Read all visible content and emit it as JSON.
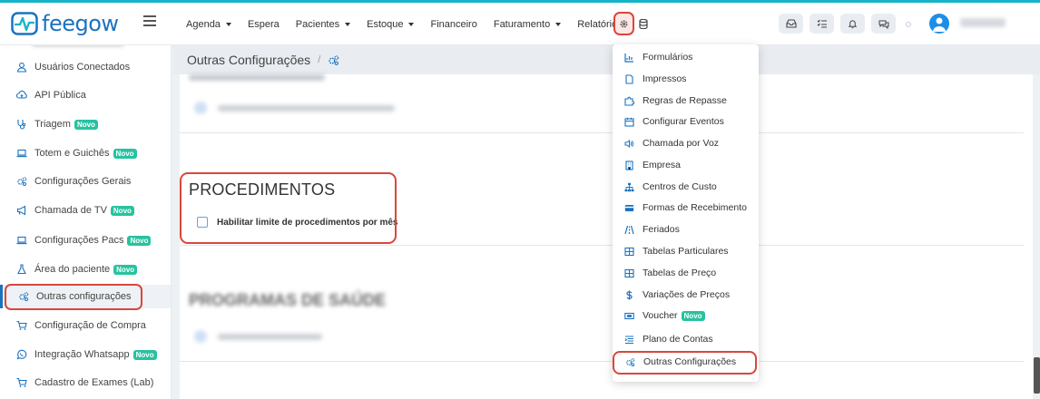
{
  "app": {
    "logo_text": "feegow",
    "accent": "#1a73c0",
    "highlight": "#d9473b",
    "badge_color": "#27c2a0"
  },
  "nav": [
    {
      "label": "Agenda",
      "caret": true
    },
    {
      "label": "Espera",
      "caret": false
    },
    {
      "label": "Pacientes",
      "caret": true
    },
    {
      "label": "Estoque",
      "caret": true
    },
    {
      "label": "Financeiro",
      "caret": false
    },
    {
      "label": "Faturamento",
      "caret": true
    },
    {
      "label": "Relatórios",
      "caret": false
    }
  ],
  "sidebar": {
    "items": [
      {
        "label": "Usuários Conectados",
        "icon": "user-icon",
        "badge": ""
      },
      {
        "label": "API Pública",
        "icon": "cloud-upload-icon",
        "badge": ""
      },
      {
        "label": "Triagem",
        "icon": "stethoscope-icon",
        "badge": "Novo"
      },
      {
        "label": "Totem e Guichês",
        "icon": "laptop-icon",
        "badge": "Novo"
      },
      {
        "label": "Configurações Gerais",
        "icon": "cogs-icon",
        "badge": ""
      },
      {
        "label": "Chamada de TV",
        "icon": "megaphone-icon",
        "badge": "Novo"
      },
      {
        "label": "Configurações Pacs",
        "icon": "laptop-icon",
        "badge": "Novo"
      },
      {
        "label": "Área do paciente",
        "icon": "flask-icon",
        "badge": "Novo"
      },
      {
        "label": "Outras configurações",
        "icon": "cogs-icon",
        "badge": "",
        "active": true
      },
      {
        "label": "Configuração de Compra",
        "icon": "cart-icon",
        "badge": ""
      },
      {
        "label": "Integração Whatsapp",
        "icon": "whatsapp-icon",
        "badge": "Novo"
      },
      {
        "label": "Cadastro de Exames (Lab)",
        "icon": "cart-icon",
        "badge": ""
      }
    ]
  },
  "breadcrumb": {
    "title": "Outras Configurações",
    "separator": "/"
  },
  "main": {
    "procedimentos": {
      "title": "PROCEDIMENTOS",
      "checkbox_label": "Habilitar limite de procedimentos por mês"
    },
    "programas_title": "PROGRAMAS DE SAÚDE"
  },
  "dropdown": {
    "items": [
      {
        "label": "Formulários",
        "icon": "chart-icon",
        "badge": ""
      },
      {
        "label": "Impressos",
        "icon": "file-icon",
        "badge": ""
      },
      {
        "label": "Regras de Repasse",
        "icon": "puzzle-icon",
        "badge": ""
      },
      {
        "label": "Configurar Eventos",
        "icon": "calendar-icon",
        "badge": ""
      },
      {
        "label": "Chamada por Voz",
        "icon": "volume-icon",
        "badge": ""
      },
      {
        "label": "Empresa",
        "icon": "building-icon",
        "badge": ""
      },
      {
        "label": "Centros de Custo",
        "icon": "sitemap-icon",
        "badge": ""
      },
      {
        "label": "Formas de Recebimento",
        "icon": "credit-card-icon",
        "badge": ""
      },
      {
        "label": "Feriados",
        "icon": "road-icon",
        "badge": ""
      },
      {
        "label": "Tabelas Particulares",
        "icon": "table-icon",
        "badge": ""
      },
      {
        "label": "Tabelas de Preço",
        "icon": "table-icon",
        "badge": ""
      },
      {
        "label": "Variações de Preços",
        "icon": "dollar-icon",
        "badge": ""
      },
      {
        "label": "Voucher",
        "icon": "ticket-icon",
        "badge": "Novo"
      },
      {
        "label": "Plano de Contas",
        "icon": "list-icon",
        "badge": ""
      },
      {
        "label": "Outras Configurações",
        "icon": "cogs-icon",
        "badge": ""
      }
    ]
  }
}
